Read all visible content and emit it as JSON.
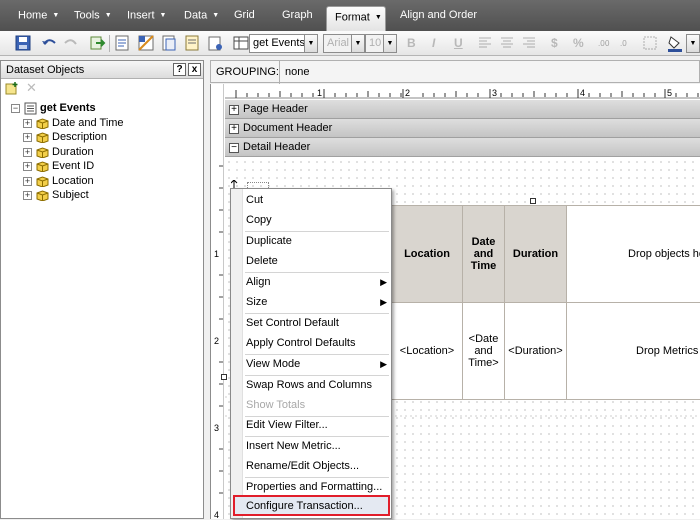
{
  "menubar": {
    "items": [
      {
        "label": "Home",
        "caret": true
      },
      {
        "label": "Tools",
        "caret": true
      },
      {
        "label": "Insert",
        "caret": true
      },
      {
        "label": "Data",
        "caret": true
      },
      {
        "label": "Grid",
        "caret": false
      },
      {
        "label": "Graph",
        "caret": false
      },
      {
        "label": "Format",
        "caret": true,
        "active": true
      },
      {
        "label": "Align and Order",
        "caret": false
      }
    ]
  },
  "toolbar": {
    "dataset_combo": "get Events",
    "font_combo": "Arial",
    "size_combo": "10",
    "bold": "B",
    "italic": "I",
    "underline": "U",
    "currency": "$",
    "percent": "%"
  },
  "left_panel": {
    "title": "Dataset Objects",
    "help": "?",
    "close": "x",
    "root": "get Events",
    "items": [
      "Date and Time",
      "Description",
      "Duration",
      "Event ID",
      "Location",
      "Subject"
    ]
  },
  "grouping": {
    "label": "GROUPING:",
    "value": "none"
  },
  "ruler": {
    "top_numbers": [
      "1",
      "2",
      "3",
      "4",
      "5"
    ],
    "left_numbers": [
      "1",
      "2",
      "3",
      "4"
    ]
  },
  "bands": {
    "page_header": "Page Header",
    "document_header": "Document Header",
    "detail_header": "Detail Header"
  },
  "grid": {
    "headers": [
      "Location",
      "Date and Time",
      "Duration",
      "Drop objects her"
    ],
    "cells": [
      "<Location>",
      "<Date and Time>",
      "<Duration>",
      "Drop Metrics he"
    ]
  },
  "context_menu": {
    "items": [
      {
        "label": "Cut"
      },
      {
        "label": "Copy"
      },
      {
        "label": "Duplicate"
      },
      {
        "label": "Delete"
      },
      {
        "label": "Align",
        "submenu": true
      },
      {
        "label": "Size",
        "submenu": true
      },
      {
        "label": "Set Control Default"
      },
      {
        "label": "Apply Control Defaults"
      },
      {
        "label": "View Mode",
        "submenu": true
      },
      {
        "label": "Swap Rows and Columns"
      },
      {
        "label": "Show Totals",
        "disabled": true
      },
      {
        "label": "Edit View Filter..."
      },
      {
        "label": "Insert New Metric..."
      },
      {
        "label": "Rename/Edit Objects..."
      },
      {
        "label": "Properties and Formatting..."
      },
      {
        "label": "Configure Transaction...",
        "highlighted": true
      }
    ]
  },
  "colors": {
    "menubar": "#5a5a5a",
    "highlight_border": "#e11d2a",
    "header_cell": "#d9d5cf"
  }
}
